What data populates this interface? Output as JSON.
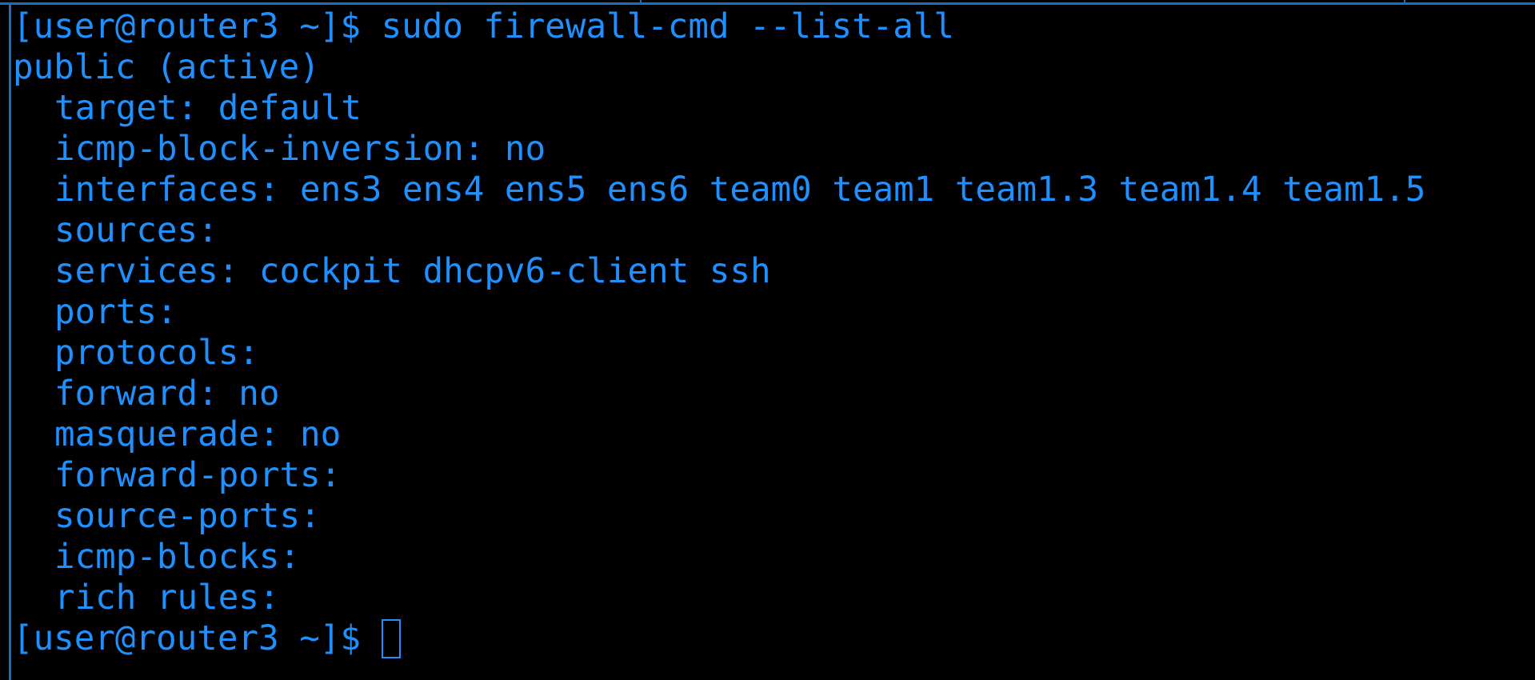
{
  "terminal": {
    "prompt": "[user@router3 ~]$",
    "command": "sudo firewall-cmd --list-all",
    "output_lines": [
      {
        "text": "public (active)",
        "indented": false
      },
      {
        "text": "target: default",
        "indented": true
      },
      {
        "text": "icmp-block-inversion: no",
        "indented": true
      },
      {
        "text": "interfaces: ens3 ens4 ens5 ens6 team0 team1 team1.3 team1.4 team1.5",
        "indented": true
      },
      {
        "text": "sources:",
        "indented": true
      },
      {
        "text": "services: cockpit dhcpv6-client ssh",
        "indented": true
      },
      {
        "text": "ports:",
        "indented": true
      },
      {
        "text": "protocols:",
        "indented": true
      },
      {
        "text": "forward: no",
        "indented": true
      },
      {
        "text": "masquerade: no",
        "indented": true
      },
      {
        "text": "forward-ports:",
        "indented": true
      },
      {
        "text": "source-ports:",
        "indented": true
      },
      {
        "text": "icmp-blocks:",
        "indented": true
      },
      {
        "text": "rich rules:",
        "indented": true
      }
    ],
    "final_prompt": "[user@router3 ~]$",
    "colors": {
      "background": "#000000",
      "text": "#1e90ff",
      "frame": "#1a6fc2"
    }
  }
}
